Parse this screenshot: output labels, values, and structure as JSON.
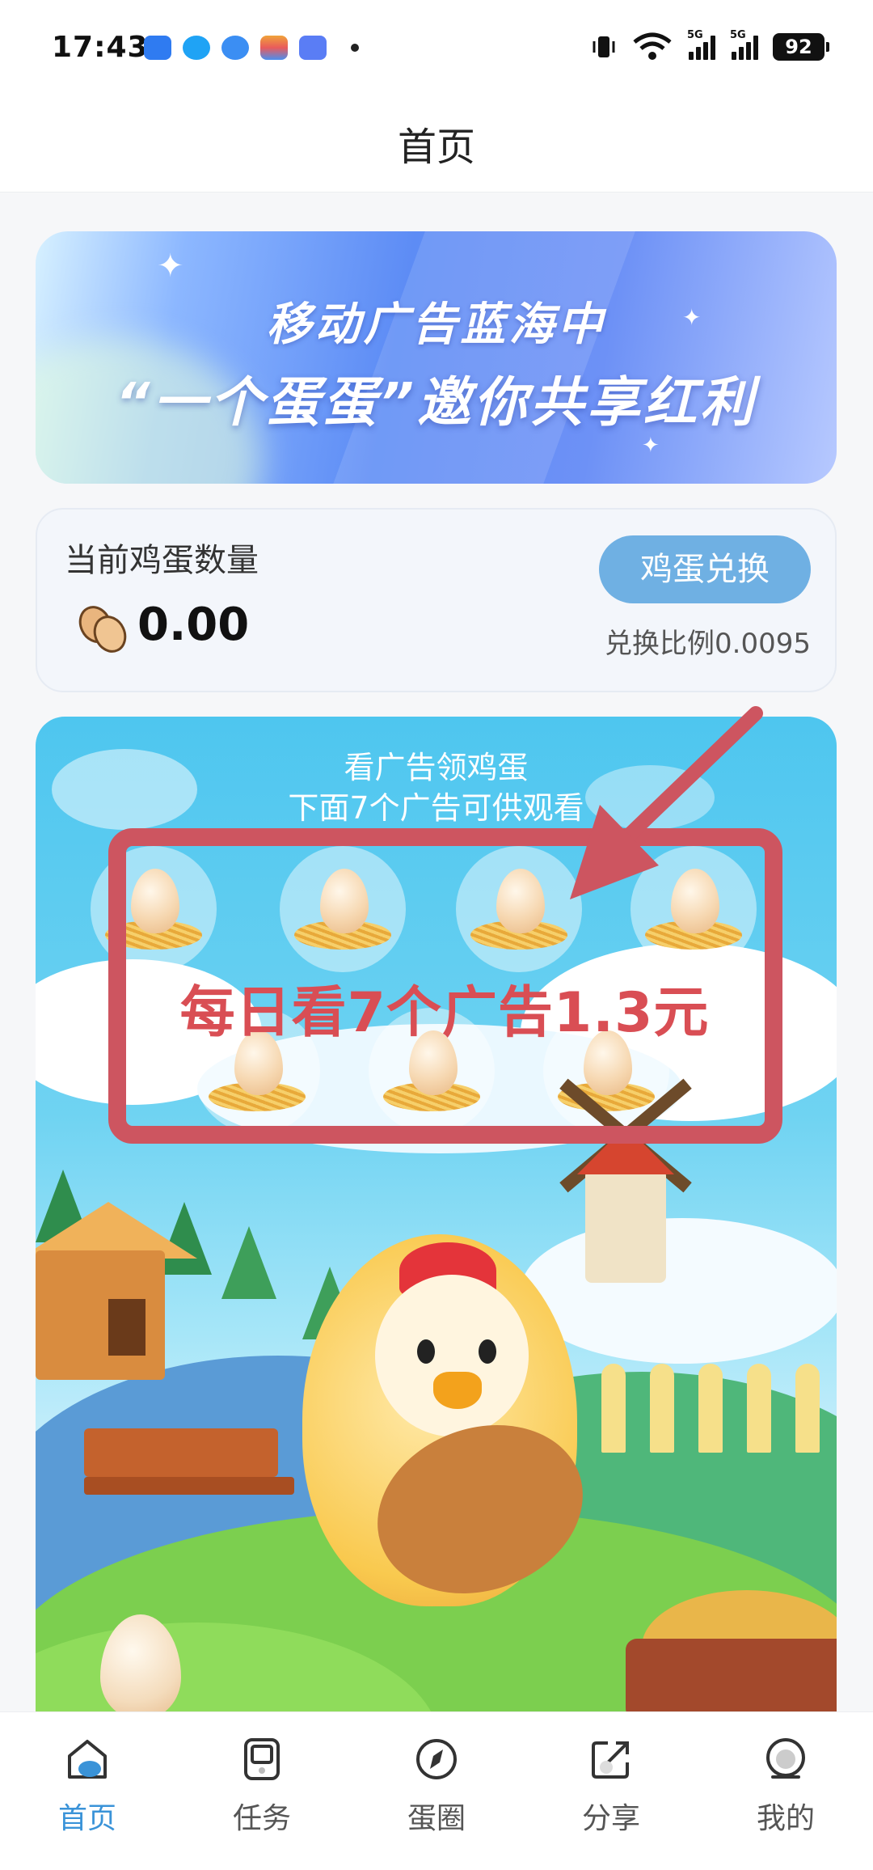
{
  "status_bar": {
    "time": "17:43",
    "battery": "92",
    "network": "5G"
  },
  "header": {
    "title": "首页"
  },
  "banner": {
    "line1": "移动广告蓝海中",
    "line2": "“一个蛋蛋”邀你共享红利"
  },
  "egg_card": {
    "title": "当前鸡蛋数量",
    "count": "0.00",
    "exchange_label": "鸡蛋兑换",
    "ratio": "兑换比例0.0095"
  },
  "game": {
    "caption1": "看广告领鸡蛋",
    "caption2": "下面7个广告可供观看",
    "egg_slots": 7
  },
  "annotation": {
    "text": "每日看7个广告1.3元",
    "color": "#cd5560"
  },
  "tabs": [
    {
      "label": "首页",
      "icon": "home-icon",
      "active": true
    },
    {
      "label": "任务",
      "icon": "task-icon",
      "active": false
    },
    {
      "label": "蛋圈",
      "icon": "compass-icon",
      "active": false
    },
    {
      "label": "分享",
      "icon": "share-icon",
      "active": false
    },
    {
      "label": "我的",
      "icon": "profile-icon",
      "active": false
    }
  ],
  "colors": {
    "accent": "#3a93d8",
    "exchange_button": "#6fb0e3",
    "annotation": "#cd5560"
  }
}
